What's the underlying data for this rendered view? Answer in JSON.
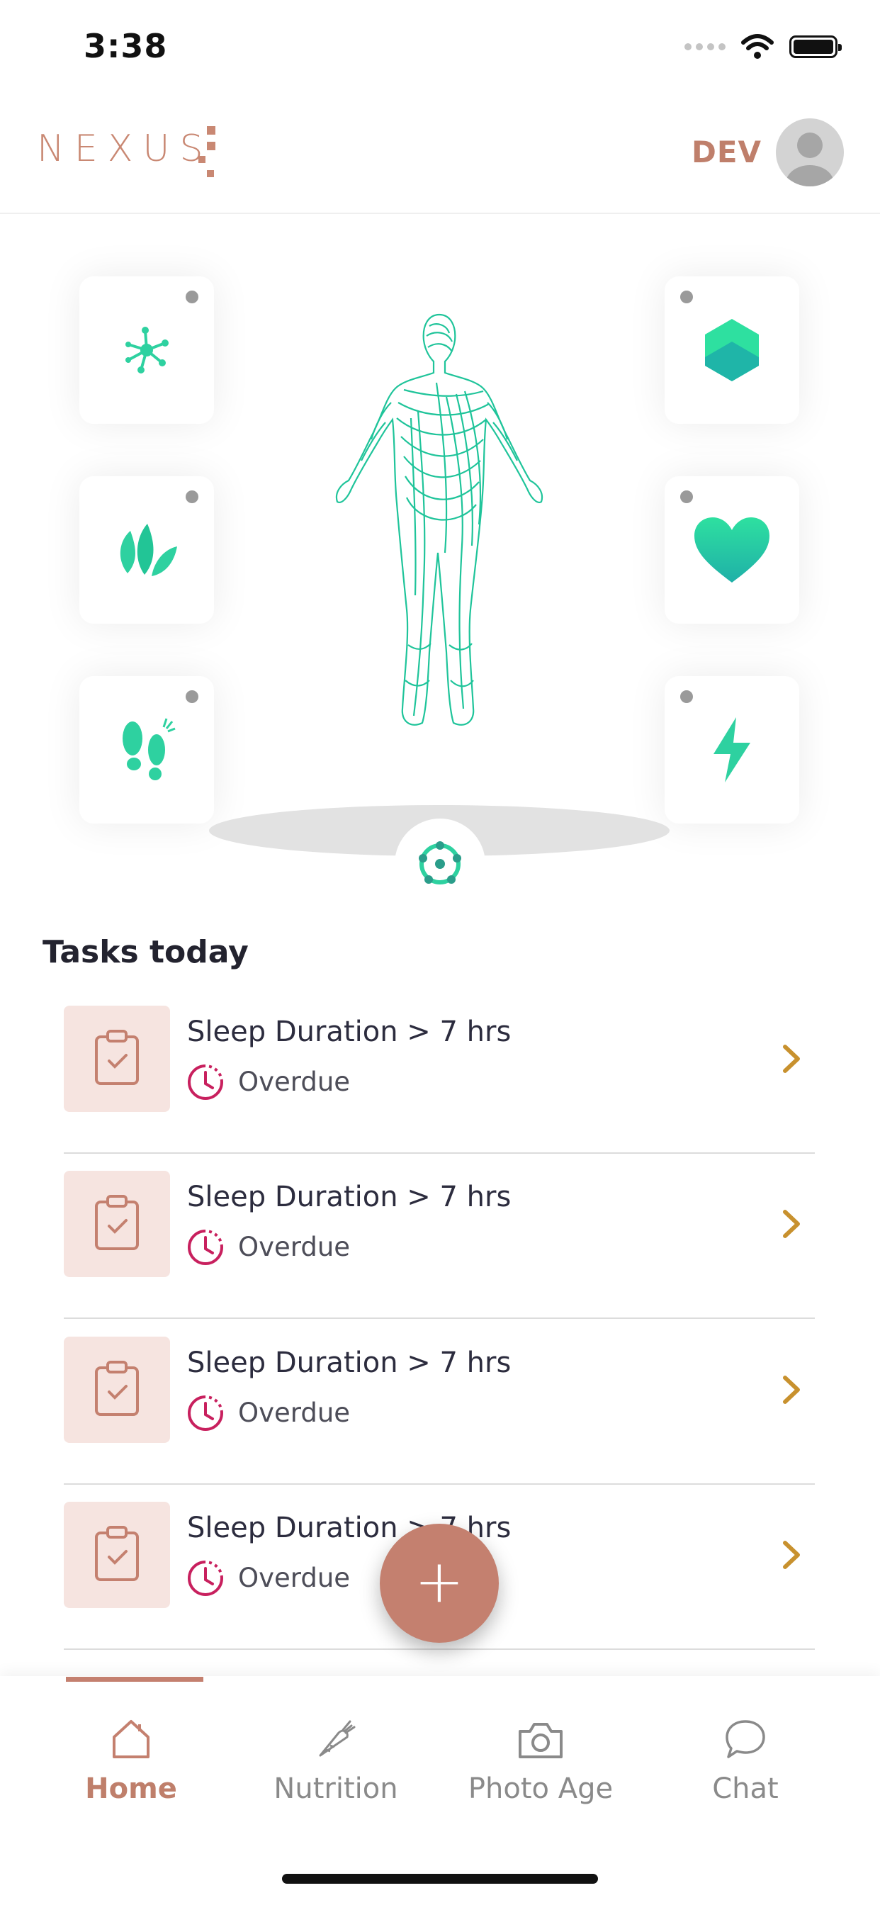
{
  "status_bar": {
    "time": "3:38",
    "icons": [
      "signal-dots-icon",
      "wifi-icon",
      "battery-icon"
    ]
  },
  "header": {
    "logo_text": "NEXUS",
    "user_name": "DEV",
    "avatar_icon": "user-avatar-icon"
  },
  "tiles": {
    "left": [
      "molecule-icon",
      "leaves-icon",
      "footprints-icon"
    ],
    "right": [
      "hexagon-icon",
      "heart-icon",
      "lightning-icon"
    ]
  },
  "center_icon": "nodes-circle-icon",
  "tasks": {
    "title": "Tasks today",
    "items": [
      {
        "title": "Sleep Duration > 7 hrs",
        "status": "Overdue"
      },
      {
        "title": "Sleep Duration > 7 hrs",
        "status": "Overdue"
      },
      {
        "title": "Sleep Duration > 7 hrs",
        "status": "Overdue"
      },
      {
        "title": "Sleep Duration > 7 hrs",
        "status": "Overdue"
      }
    ]
  },
  "fab": {
    "label": "+"
  },
  "nav": {
    "items": [
      {
        "label": "Home",
        "icon": "home-icon",
        "active": true
      },
      {
        "label": "Nutrition",
        "icon": "carrot-icon",
        "active": false
      },
      {
        "label": "Photo Age",
        "icon": "camera-icon",
        "active": false
      },
      {
        "label": "Chat",
        "icon": "chat-bubble-icon",
        "active": false
      }
    ]
  },
  "colors": {
    "accent": "#c4806f",
    "teal": "#2ed1a0",
    "overdue": "#c8205e",
    "chevron": "#c8912e"
  }
}
